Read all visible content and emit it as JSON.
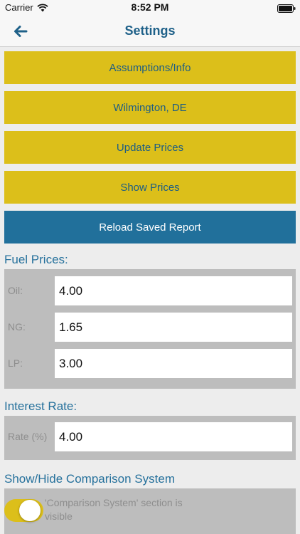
{
  "status_bar": {
    "carrier": "Carrier",
    "time": "8:52 PM"
  },
  "nav": {
    "title": "Settings",
    "back_icon": "arrow-left-icon"
  },
  "buttons": {
    "assumptions": "Assumptions/Info",
    "location": "Wilmington, DE",
    "update_prices": "Update Prices",
    "show_prices": "Show Prices",
    "reload_report": "Reload Saved Report"
  },
  "fuel_prices": {
    "title": "Fuel Prices:",
    "fields": [
      {
        "label": "Oil:",
        "value": "4.00"
      },
      {
        "label": "NG:",
        "value": "1.65"
      },
      {
        "label": "LP:",
        "value": "3.00"
      }
    ]
  },
  "interest_rate": {
    "title": "Interest Rate:",
    "label": "Rate (%)",
    "value": "4.00"
  },
  "comparison": {
    "title": "Show/Hide Comparison System",
    "toggle_on": true,
    "description": "'Comparison System' section is visible"
  },
  "colors": {
    "accent_yellow": "#dcbf1a",
    "accent_blue": "#21709b",
    "title_blue": "#1f6189"
  }
}
